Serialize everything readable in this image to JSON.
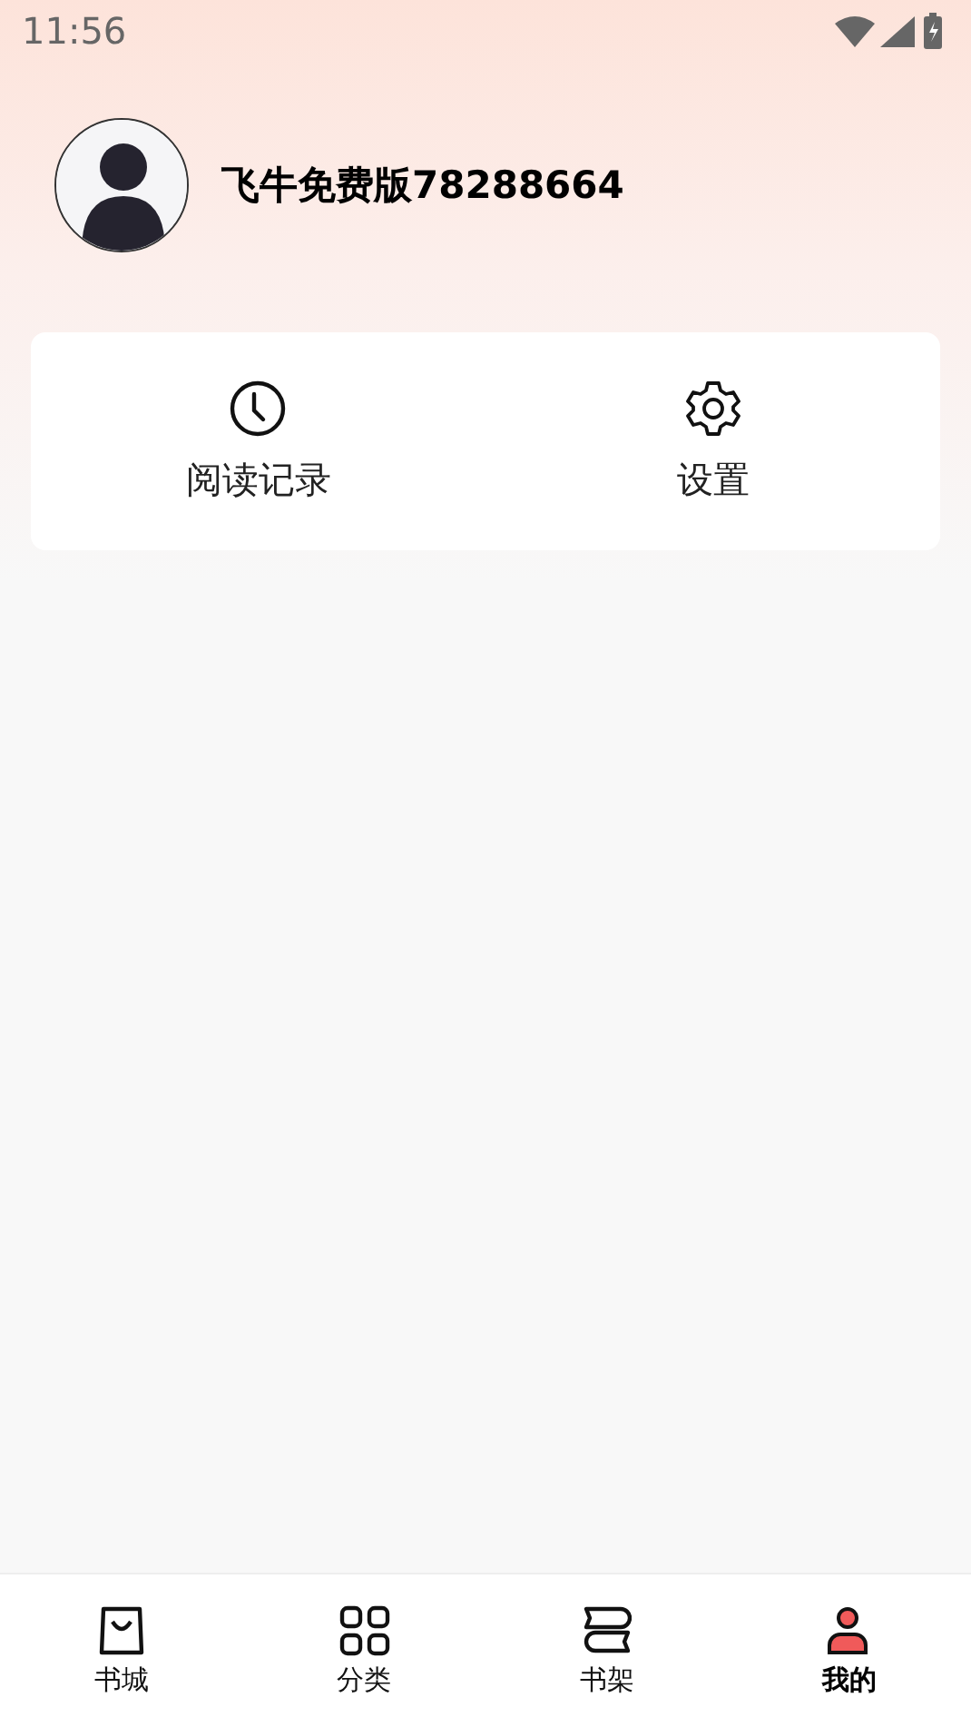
{
  "status_bar": {
    "time": "11:56"
  },
  "profile": {
    "username": "飞牛免费版78288664"
  },
  "shortcuts": [
    {
      "kind": "clock",
      "label": "阅读记录"
    },
    {
      "kind": "gear",
      "label": "设置"
    }
  ],
  "tabs": [
    {
      "kind": "bag",
      "label": "书城",
      "selected": false
    },
    {
      "kind": "grid",
      "label": "分类",
      "selected": false
    },
    {
      "kind": "books",
      "label": "书架",
      "selected": false
    },
    {
      "kind": "person",
      "label": "我的",
      "selected": true
    }
  ]
}
